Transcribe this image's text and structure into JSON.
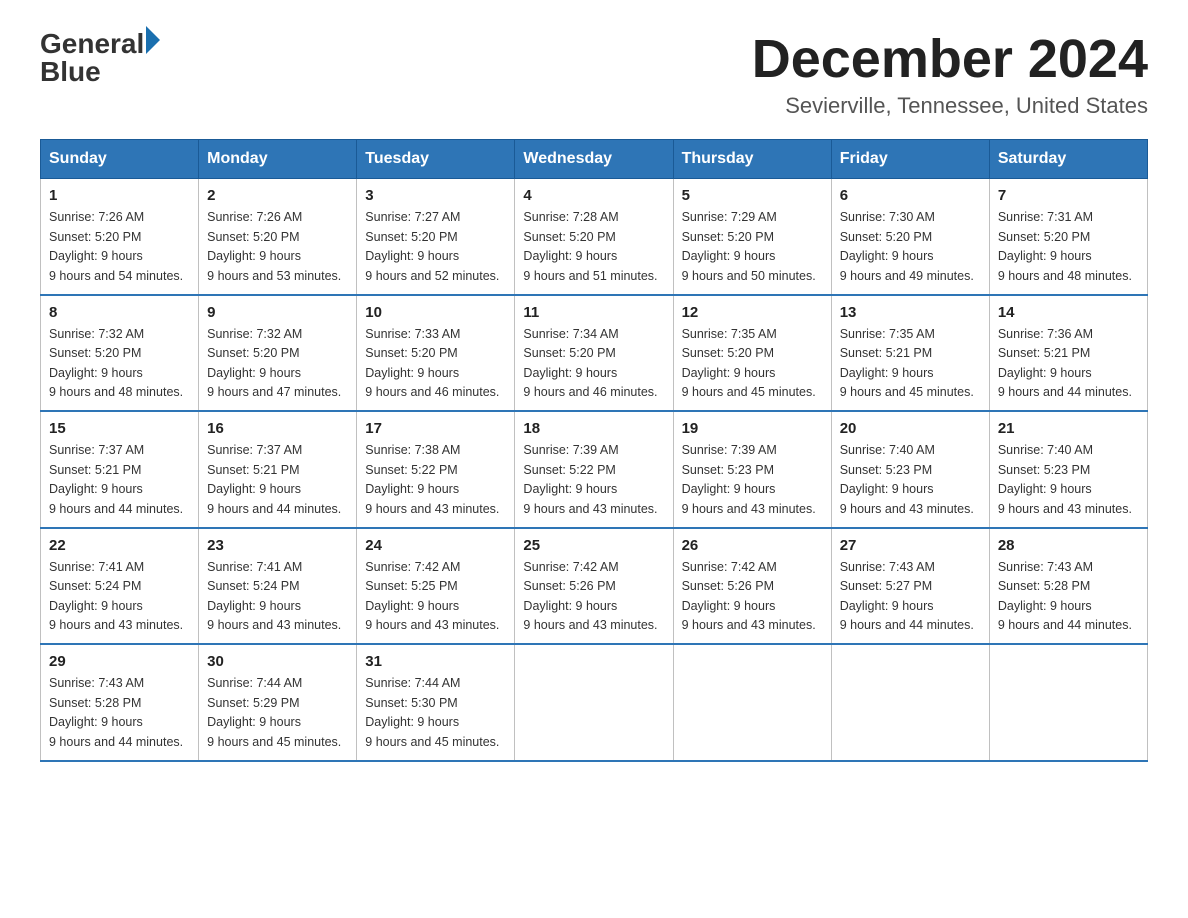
{
  "header": {
    "logo_text_general": "General",
    "logo_text_blue": "Blue",
    "month_title": "December 2024",
    "location": "Sevierville, Tennessee, United States"
  },
  "days_of_week": [
    "Sunday",
    "Monday",
    "Tuesday",
    "Wednesday",
    "Thursday",
    "Friday",
    "Saturday"
  ],
  "weeks": [
    [
      {
        "day": "1",
        "sunrise": "7:26 AM",
        "sunset": "5:20 PM",
        "daylight": "9 hours and 54 minutes."
      },
      {
        "day": "2",
        "sunrise": "7:26 AM",
        "sunset": "5:20 PM",
        "daylight": "9 hours and 53 minutes."
      },
      {
        "day": "3",
        "sunrise": "7:27 AM",
        "sunset": "5:20 PM",
        "daylight": "9 hours and 52 minutes."
      },
      {
        "day": "4",
        "sunrise": "7:28 AM",
        "sunset": "5:20 PM",
        "daylight": "9 hours and 51 minutes."
      },
      {
        "day": "5",
        "sunrise": "7:29 AM",
        "sunset": "5:20 PM",
        "daylight": "9 hours and 50 minutes."
      },
      {
        "day": "6",
        "sunrise": "7:30 AM",
        "sunset": "5:20 PM",
        "daylight": "9 hours and 49 minutes."
      },
      {
        "day": "7",
        "sunrise": "7:31 AM",
        "sunset": "5:20 PM",
        "daylight": "9 hours and 48 minutes."
      }
    ],
    [
      {
        "day": "8",
        "sunrise": "7:32 AM",
        "sunset": "5:20 PM",
        "daylight": "9 hours and 48 minutes."
      },
      {
        "day": "9",
        "sunrise": "7:32 AM",
        "sunset": "5:20 PM",
        "daylight": "9 hours and 47 minutes."
      },
      {
        "day": "10",
        "sunrise": "7:33 AM",
        "sunset": "5:20 PM",
        "daylight": "9 hours and 46 minutes."
      },
      {
        "day": "11",
        "sunrise": "7:34 AM",
        "sunset": "5:20 PM",
        "daylight": "9 hours and 46 minutes."
      },
      {
        "day": "12",
        "sunrise": "7:35 AM",
        "sunset": "5:20 PM",
        "daylight": "9 hours and 45 minutes."
      },
      {
        "day": "13",
        "sunrise": "7:35 AM",
        "sunset": "5:21 PM",
        "daylight": "9 hours and 45 minutes."
      },
      {
        "day": "14",
        "sunrise": "7:36 AM",
        "sunset": "5:21 PM",
        "daylight": "9 hours and 44 minutes."
      }
    ],
    [
      {
        "day": "15",
        "sunrise": "7:37 AM",
        "sunset": "5:21 PM",
        "daylight": "9 hours and 44 minutes."
      },
      {
        "day": "16",
        "sunrise": "7:37 AM",
        "sunset": "5:21 PM",
        "daylight": "9 hours and 44 minutes."
      },
      {
        "day": "17",
        "sunrise": "7:38 AM",
        "sunset": "5:22 PM",
        "daylight": "9 hours and 43 minutes."
      },
      {
        "day": "18",
        "sunrise": "7:39 AM",
        "sunset": "5:22 PM",
        "daylight": "9 hours and 43 minutes."
      },
      {
        "day": "19",
        "sunrise": "7:39 AM",
        "sunset": "5:23 PM",
        "daylight": "9 hours and 43 minutes."
      },
      {
        "day": "20",
        "sunrise": "7:40 AM",
        "sunset": "5:23 PM",
        "daylight": "9 hours and 43 minutes."
      },
      {
        "day": "21",
        "sunrise": "7:40 AM",
        "sunset": "5:23 PM",
        "daylight": "9 hours and 43 minutes."
      }
    ],
    [
      {
        "day": "22",
        "sunrise": "7:41 AM",
        "sunset": "5:24 PM",
        "daylight": "9 hours and 43 minutes."
      },
      {
        "day": "23",
        "sunrise": "7:41 AM",
        "sunset": "5:24 PM",
        "daylight": "9 hours and 43 minutes."
      },
      {
        "day": "24",
        "sunrise": "7:42 AM",
        "sunset": "5:25 PM",
        "daylight": "9 hours and 43 minutes."
      },
      {
        "day": "25",
        "sunrise": "7:42 AM",
        "sunset": "5:26 PM",
        "daylight": "9 hours and 43 minutes."
      },
      {
        "day": "26",
        "sunrise": "7:42 AM",
        "sunset": "5:26 PM",
        "daylight": "9 hours and 43 minutes."
      },
      {
        "day": "27",
        "sunrise": "7:43 AM",
        "sunset": "5:27 PM",
        "daylight": "9 hours and 44 minutes."
      },
      {
        "day": "28",
        "sunrise": "7:43 AM",
        "sunset": "5:28 PM",
        "daylight": "9 hours and 44 minutes."
      }
    ],
    [
      {
        "day": "29",
        "sunrise": "7:43 AM",
        "sunset": "5:28 PM",
        "daylight": "9 hours and 44 minutes."
      },
      {
        "day": "30",
        "sunrise": "7:44 AM",
        "sunset": "5:29 PM",
        "daylight": "9 hours and 45 minutes."
      },
      {
        "day": "31",
        "sunrise": "7:44 AM",
        "sunset": "5:30 PM",
        "daylight": "9 hours and 45 minutes."
      },
      null,
      null,
      null,
      null
    ]
  ]
}
